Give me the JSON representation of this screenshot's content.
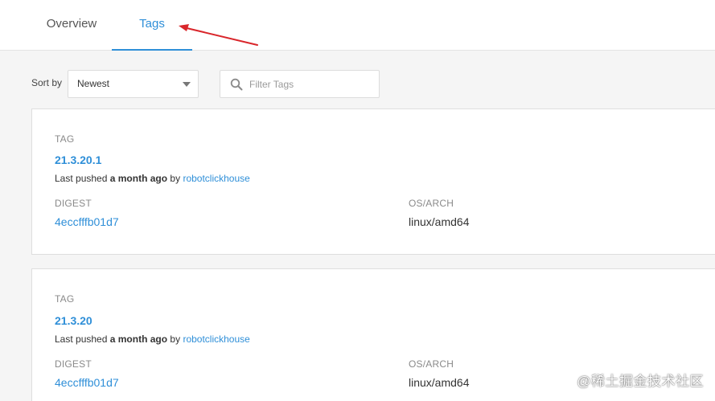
{
  "tabs": {
    "overview": "Overview",
    "tags": "Tags"
  },
  "controls": {
    "sort_label": "Sort by",
    "sort_selected": "Newest",
    "filter_placeholder": "Filter Tags"
  },
  "tag_cards": [
    {
      "tag_label": "TAG",
      "tag": "21.3.20.1",
      "pushed_prefix": "Last pushed",
      "pushed_when": "a month ago",
      "pushed_by_word": "by",
      "pushed_by": "robotclickhouse",
      "digest_label": "DIGEST",
      "digest": "4eccfffb01d7",
      "osarch_label": "OS/ARCH",
      "osarch": "linux/amd64"
    },
    {
      "tag_label": "TAG",
      "tag": "21.3.20",
      "pushed_prefix": "Last pushed",
      "pushed_when": "a month ago",
      "pushed_by_word": "by",
      "pushed_by": "robotclickhouse",
      "digest_label": "DIGEST",
      "digest": "4eccfffb01d7",
      "osarch_label": "OS/ARCH",
      "osarch": "linux/amd64"
    }
  ],
  "watermark": "@稀土掘金技术社区",
  "colors": {
    "accent": "#2f8fd8",
    "annotation_arrow": "#d9262b"
  },
  "icons": {
    "filter": "search-icon",
    "sort": "caret-down-icon",
    "annotation": "red-arrow-icon"
  }
}
